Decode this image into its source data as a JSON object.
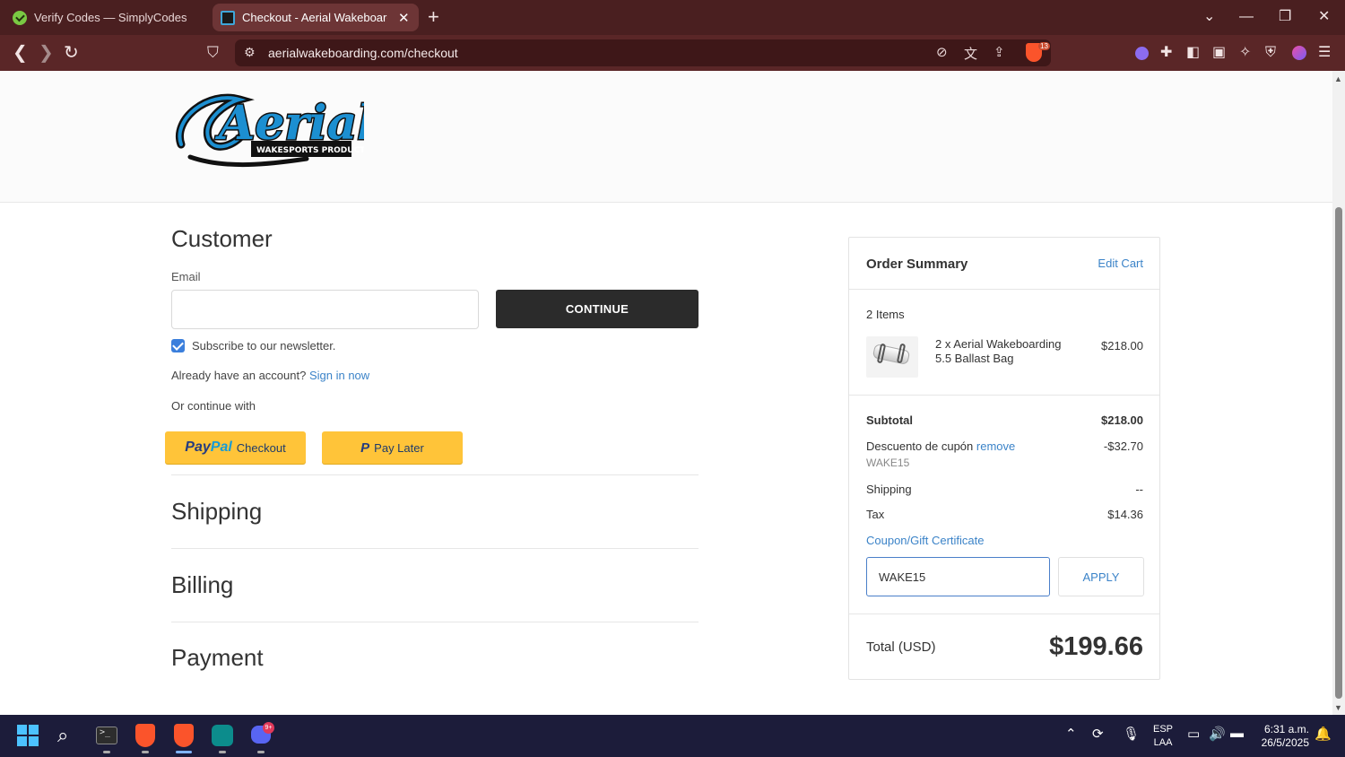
{
  "browser": {
    "tabs": [
      {
        "title": "Verify Codes — SimplyCodes",
        "active": false
      },
      {
        "title": "Checkout - Aerial Wakeboarding",
        "active": true
      }
    ],
    "url": "aerialwakeboarding.com/checkout",
    "shield_count": "13",
    "theme_color": "#4a1f20"
  },
  "store": {
    "logo_text": "Aerial",
    "logo_subtext": "WAKESPORTS PRODUCTS"
  },
  "customer": {
    "heading": "Customer",
    "email_label": "Email",
    "email_value": "",
    "continue_label": "CONTINUE",
    "newsletter_label": "Subscribe to our newsletter.",
    "newsletter_checked": true,
    "account_prompt": "Already have an account?",
    "signin_label": "Sign in now",
    "or_continue": "Or continue with",
    "paypal_label": "Checkout",
    "paylater_label": "Pay Later"
  },
  "sections": {
    "shipping": "Shipping",
    "billing": "Billing",
    "payment": "Payment"
  },
  "summary": {
    "title": "Order Summary",
    "edit_cart": "Edit Cart",
    "items_count": "2 Items",
    "product_name": "2 x Aerial Wakeboarding 5.5 Ballast Bag",
    "product_price": "$218.00",
    "subtotal_label": "Subtotal",
    "subtotal_value": "$218.00",
    "discount_label": "Descuento de cupón",
    "discount_remove": "remove",
    "discount_code": "WAKE15",
    "discount_value": "-$32.70",
    "shipping_label": "Shipping",
    "shipping_value": "--",
    "tax_label": "Tax",
    "tax_value": "$14.36",
    "coupon_link": "Coupon/Gift Certificate",
    "coupon_input": "WAKE15",
    "apply_label": "APPLY",
    "total_label": "Total (USD)",
    "total_value": "$199.66"
  },
  "taskbar": {
    "language_line1": "ESP",
    "language_line2": "LAA",
    "time": "6:31 a.m.",
    "date": "26/5/2025",
    "discord_badge": "9+"
  }
}
